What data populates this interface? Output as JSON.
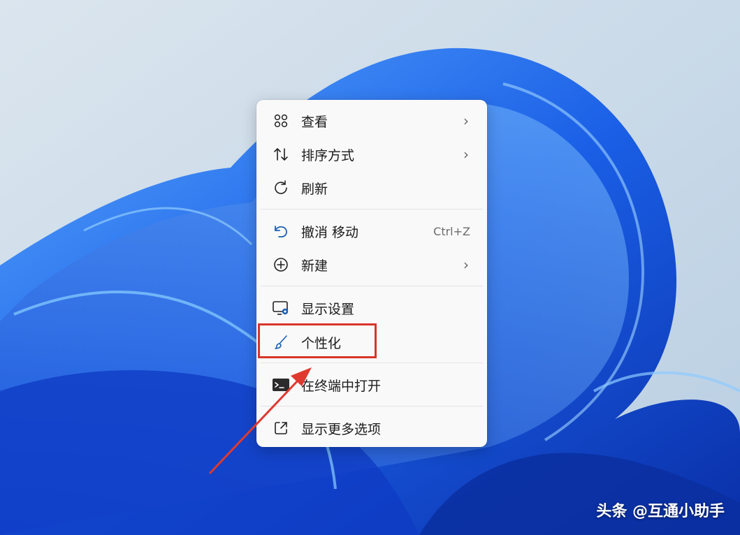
{
  "menu": {
    "items": [
      {
        "label": "查看",
        "icon": "grid-icon",
        "submenu": true
      },
      {
        "label": "排序方式",
        "icon": "sort-icon",
        "submenu": true
      },
      {
        "label": "刷新",
        "icon": "refresh-icon"
      },
      {
        "label": "撤消 移动",
        "icon": "undo-icon",
        "shortcut": "Ctrl+Z"
      },
      {
        "label": "新建",
        "icon": "new-plus-icon",
        "submenu": true
      },
      {
        "label": "显示设置",
        "icon": "display-settings-icon"
      },
      {
        "label": "个性化",
        "icon": "brush-icon"
      },
      {
        "label": "在终端中打开",
        "icon": "terminal-icon"
      },
      {
        "label": "显示更多选项",
        "icon": "more-options-icon"
      }
    ]
  },
  "chevron": "›",
  "watermark": "头条 @互通小助手",
  "colors": {
    "accent": "#1a5fb4",
    "highlight_box": "#d9342b",
    "menu_bg": "#f9f9f9"
  }
}
